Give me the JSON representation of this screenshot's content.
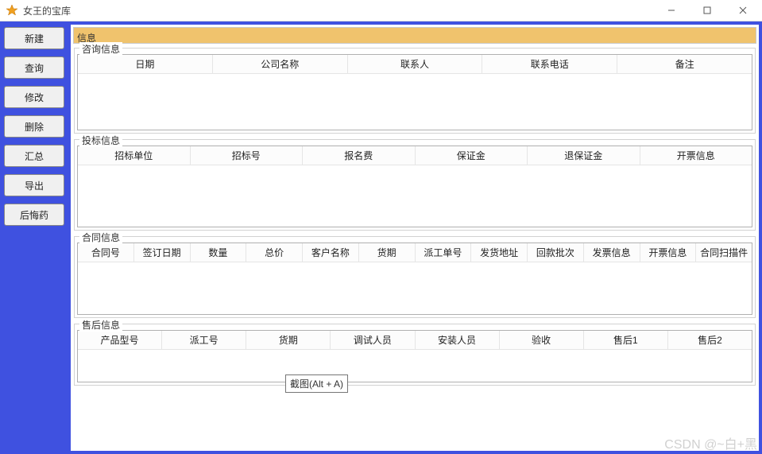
{
  "window": {
    "title": "女王的宝库"
  },
  "sidebar": {
    "buttons": [
      {
        "label": "新建"
      },
      {
        "label": "查询"
      },
      {
        "label": "修改"
      },
      {
        "label": "删除"
      },
      {
        "label": "汇总"
      },
      {
        "label": "导出"
      },
      {
        "label": "后悔药"
      }
    ]
  },
  "panel": {
    "title": "信息",
    "sections": [
      {
        "title": "咨询信息",
        "cols": [
          "日期",
          "公司名称",
          "联系人",
          "联系电话",
          "备注"
        ]
      },
      {
        "title": "投标信息",
        "cols": [
          "招标单位",
          "招标号",
          "报名费",
          "保证金",
          "退保证金",
          "开票信息"
        ]
      },
      {
        "title": "合同信息",
        "cols": [
          "合同号",
          "签订日期",
          "数量",
          "总价",
          "客户名称",
          "货期",
          "派工单号",
          "发货地址",
          "回款批次",
          "发票信息",
          "开票信息",
          "合同扫描件"
        ]
      },
      {
        "title": "售后信息",
        "cols": [
          "产品型号",
          "派工号",
          "货期",
          "调试人员",
          "安装人员",
          "验收",
          "售后1",
          "售后2"
        ]
      }
    ]
  },
  "tooltip": "截图(Alt + A)",
  "watermark": "CSDN @~白+黑"
}
